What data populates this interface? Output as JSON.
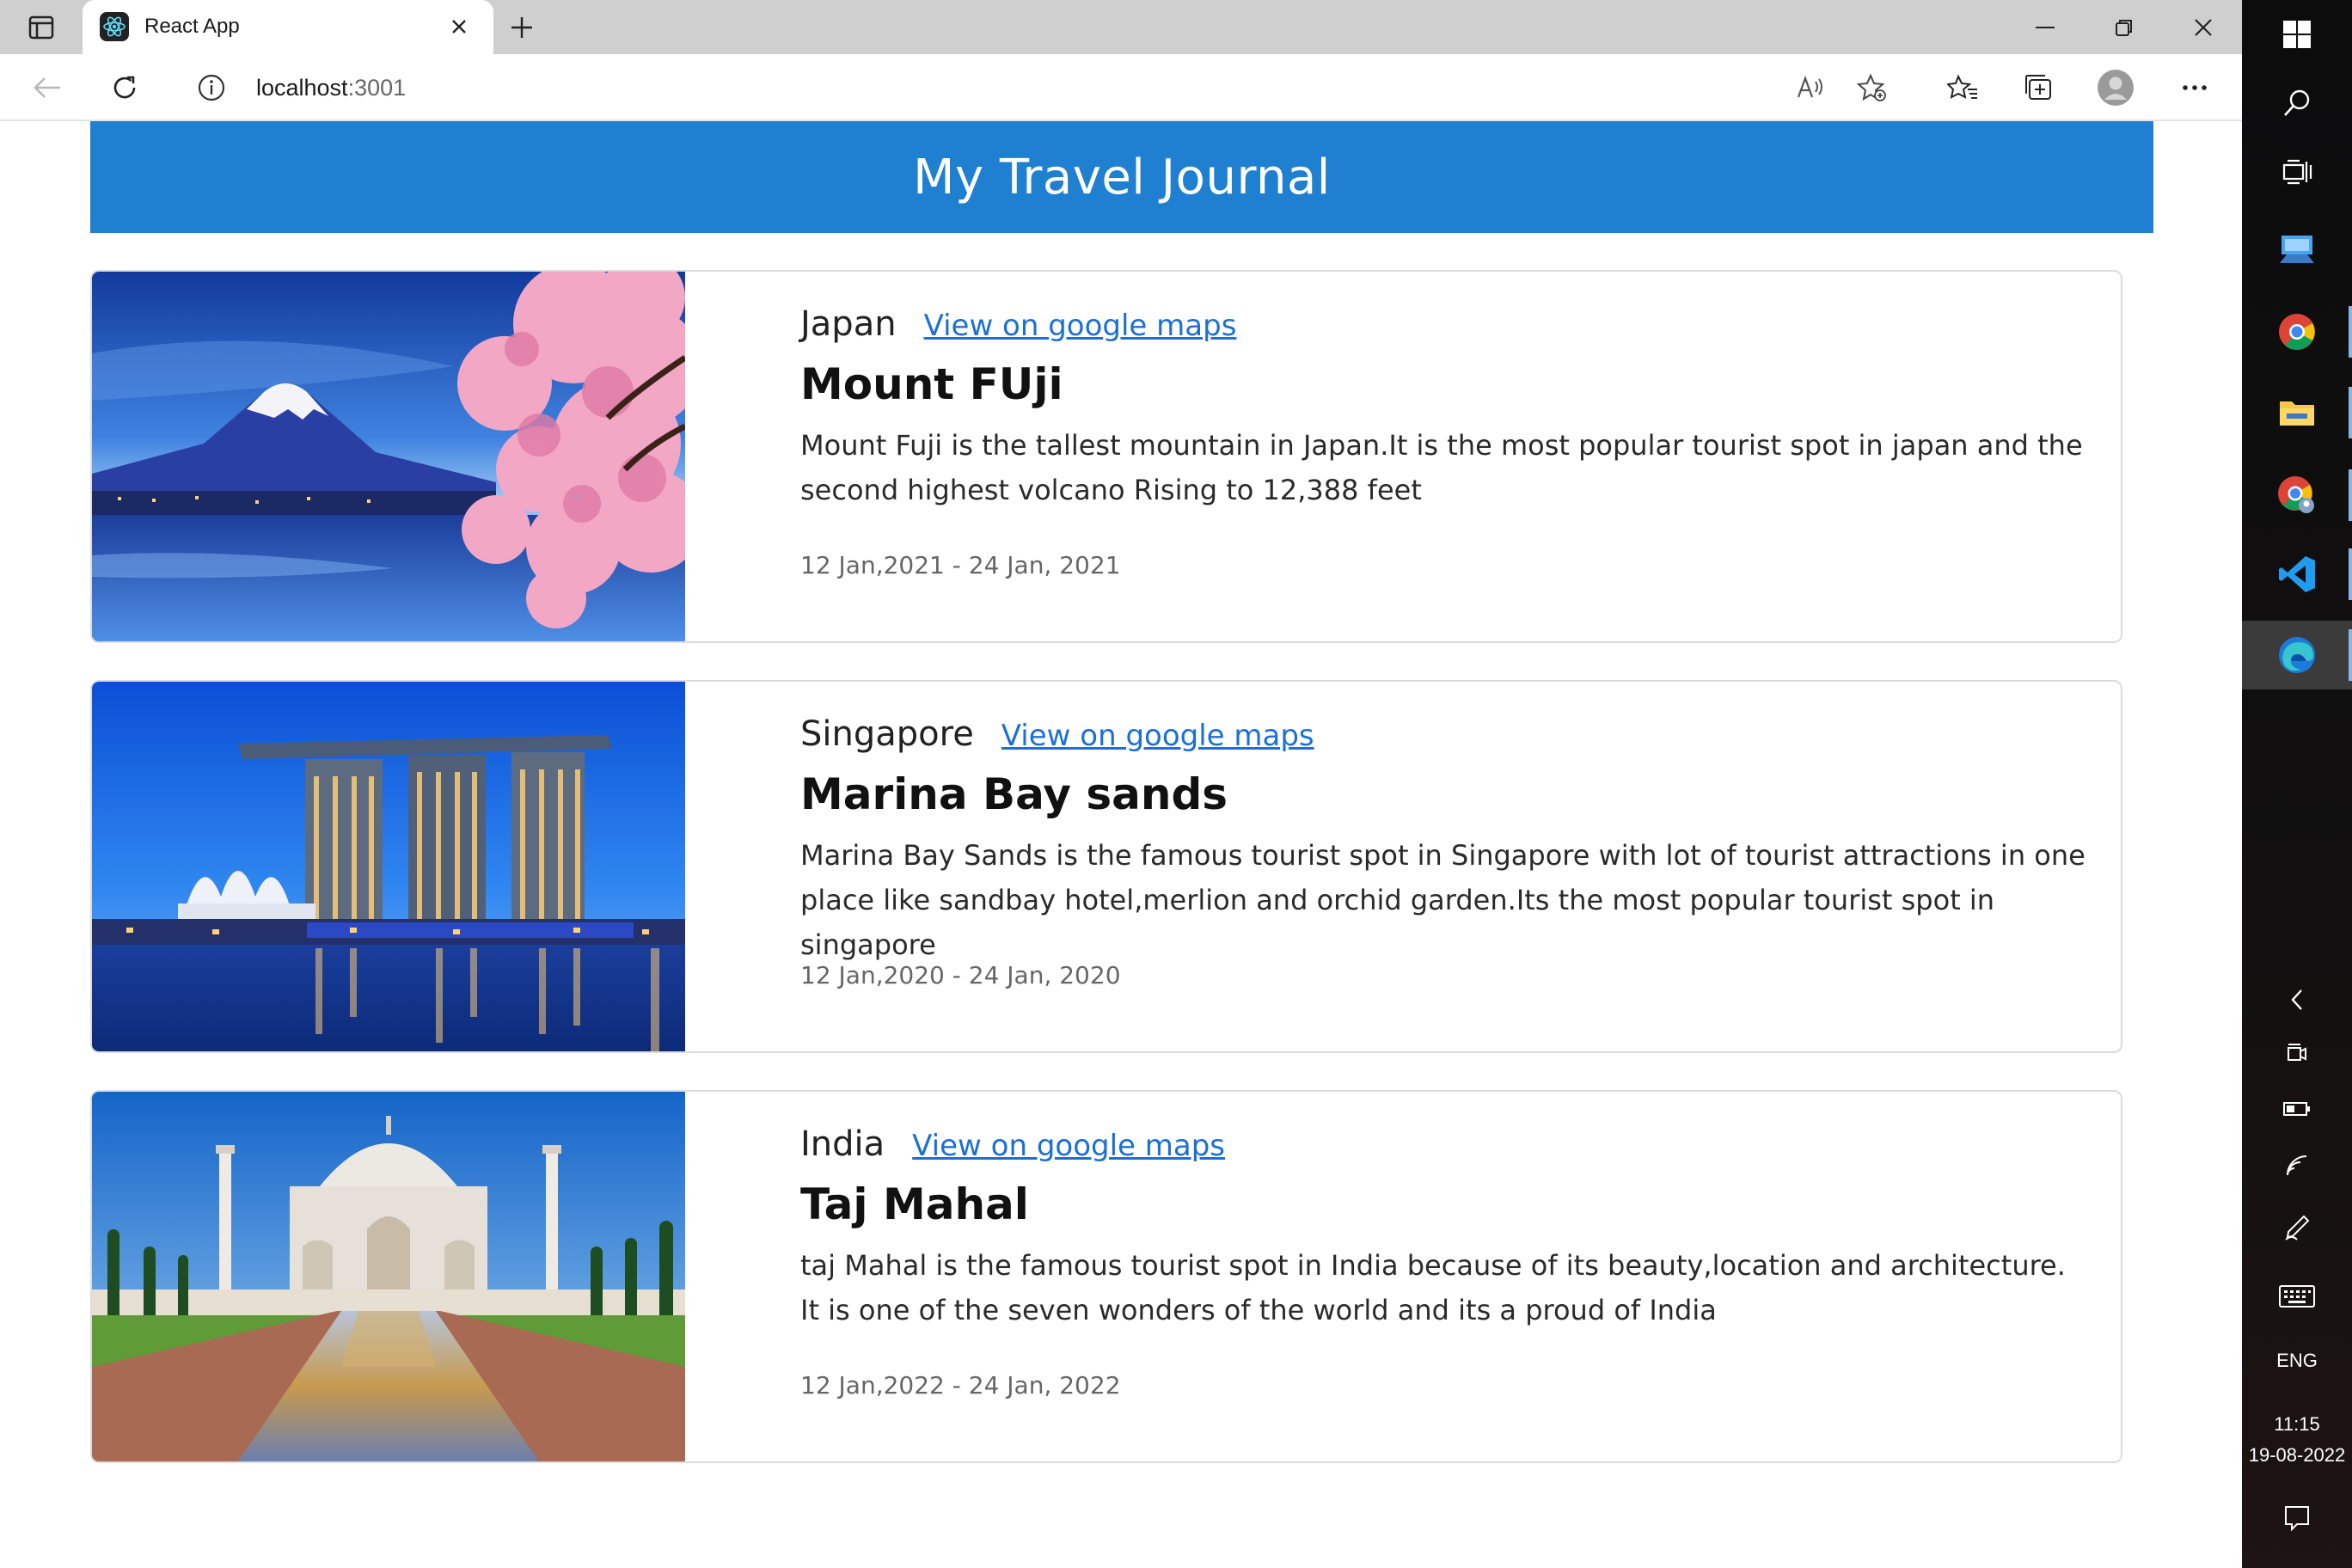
{
  "browser": {
    "tab_title": "React App",
    "url_host": "localhost",
    "url_port": ":3001"
  },
  "page": {
    "header_title": "My Travel Journal",
    "entries": [
      {
        "country": "Japan",
        "map_link": "View on google maps",
        "title": "Mount FUji",
        "description": "Mount Fuji is the tallest mountain in Japan.It is the most popular tourist spot in japan and the second highest volcano Rising to 12,388 feet",
        "dates": "12 Jan,2021 - 24 Jan, 2021"
      },
      {
        "country": "Singapore",
        "map_link": "View on google maps",
        "title": "Marina Bay sands",
        "description": "Marina Bay Sands is the famous tourist spot in Singapore with lot of tourist attractions in one place like sandbay hotel,merlion and orchid garden.Its the most popular tourist spot in singapore",
        "dates": "12 Jan,2020 - 24 Jan, 2020"
      },
      {
        "country": "India",
        "map_link": "View on google maps",
        "title": "Taj Mahal",
        "description": "taj Mahal is the famous tourist spot in India because of its beauty,location and architecture. It is one of the seven wonders of the world and its a proud of India",
        "dates": "12 Jan,2022 - 24 Jan, 2022"
      }
    ]
  },
  "taskbar": {
    "language": "ENG",
    "time": "11:15",
    "date": "19-08-2022",
    "apps": [
      "windows-start-icon",
      "search-icon",
      "task-view-icon",
      "remote-desktop-icon",
      "chrome-icon",
      "file-explorer-icon",
      "chrome-profile-icon",
      "vscode-icon",
      "edge-icon"
    ]
  },
  "colors": {
    "header_blue": "#1f7fd1",
    "link_blue": "#1b6fd6"
  }
}
